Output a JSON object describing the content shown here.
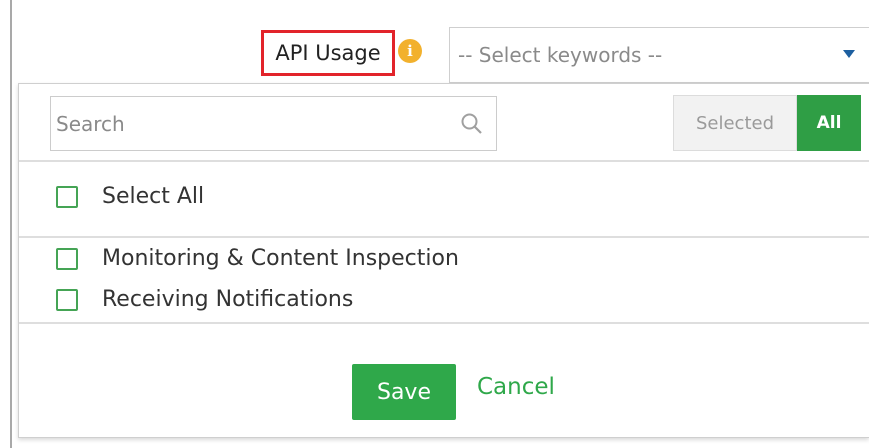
{
  "filter": {
    "label": "API Usage",
    "info_icon": "info-icon",
    "keywords_placeholder": "-- Select keywords --"
  },
  "panel": {
    "search_placeholder": "Search",
    "search_icon": "search-icon",
    "toggle": {
      "selected_label": "Selected",
      "all_label": "All",
      "active": "All"
    },
    "select_all_label": "Select All",
    "options": [
      {
        "label": "Monitoring & Content Inspection",
        "checked": false
      },
      {
        "label": "Receiving Notifications",
        "checked": false
      }
    ],
    "save_label": "Save",
    "cancel_label": "Cancel"
  },
  "colors": {
    "accent_green": "#2fa84a",
    "highlight_red": "#e2232a",
    "info_orange": "#f2b12d",
    "caret_blue": "#1d5fa0"
  }
}
